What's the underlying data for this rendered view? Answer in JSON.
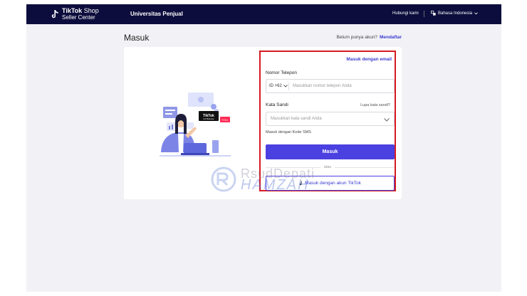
{
  "header": {
    "logo_line1_bold": "TikTok",
    "logo_line1_light": "Shop",
    "logo_line2": "Seller Center",
    "university": "Universitas Penjual",
    "contact": "Hubungi kami",
    "language": "Bahasa Indonesia"
  },
  "page": {
    "title": "Masuk",
    "no_account": "Belum punya akun?",
    "signup": "Mendaftar"
  },
  "illustration": {
    "badge_title": "TikTok",
    "badge_sub": "For Business",
    "tag": "Follow"
  },
  "form": {
    "email_login": "Masuk dengan email",
    "phone_label": "Nomor Telepon",
    "country_code": "ID +62",
    "phone_placeholder": "Masukkan nomor telepon Anda",
    "password_label": "Kata Sandi",
    "forgot": "Lupa kata sandi?",
    "password_placeholder": "Masukkan kata sandi Anda",
    "sms_login": "Masuk dengan Kode SMS",
    "submit": "Masuk",
    "or": "atau",
    "tiktok_login": "Masuk dengan akun TikTok"
  },
  "watermark": {
    "line1": "RsudDepati",
    "line2": "HAMZAH"
  },
  "colors": {
    "header_bg": "#0d0d3d",
    "primary": "#4b40e0",
    "highlight_border": "#d7191f",
    "page_bg": "#f2f2f6"
  }
}
